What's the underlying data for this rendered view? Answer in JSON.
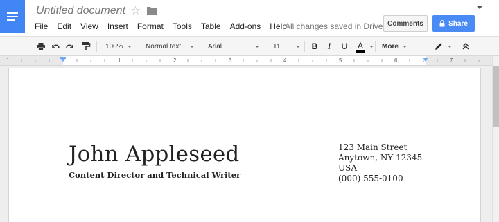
{
  "document": {
    "title": "Untitled document"
  },
  "menu": [
    "File",
    "Edit",
    "View",
    "Insert",
    "Format",
    "Tools",
    "Table",
    "Add-ons",
    "Help"
  ],
  "save_status": "All changes saved in Drive",
  "buttons": {
    "comments": "Comments",
    "share": "Share"
  },
  "toolbar": {
    "zoom": "100%",
    "style": "Normal text",
    "font": "Arial",
    "font_size": "11",
    "bold": "B",
    "italic": "I",
    "underline": "U",
    "text_color": "A",
    "more": "More"
  },
  "ruler": {
    "numbers": [
      "1",
      "1",
      "2",
      "3",
      "4",
      "5",
      "6",
      "7"
    ]
  },
  "icons": {
    "app": "docs-menu-icon",
    "star": "star-icon",
    "folder": "folder-icon",
    "print": "print-icon",
    "undo": "undo-icon",
    "redo": "redo-icon",
    "paint_format": "paint-format-icon",
    "pencil": "pencil-icon",
    "collapse": "collapse-icon",
    "lock": "lock-icon"
  },
  "colors": {
    "accent": "#4285f4",
    "share_button": "#4a8af4",
    "text_color_bar": "#000000"
  },
  "content": {
    "name": "John Appleseed",
    "subtitle": "Content Director and Technical Writer",
    "address": [
      "123 Main Street",
      "Anytown, NY 12345",
      "USA",
      "(000) 555-0100"
    ]
  }
}
